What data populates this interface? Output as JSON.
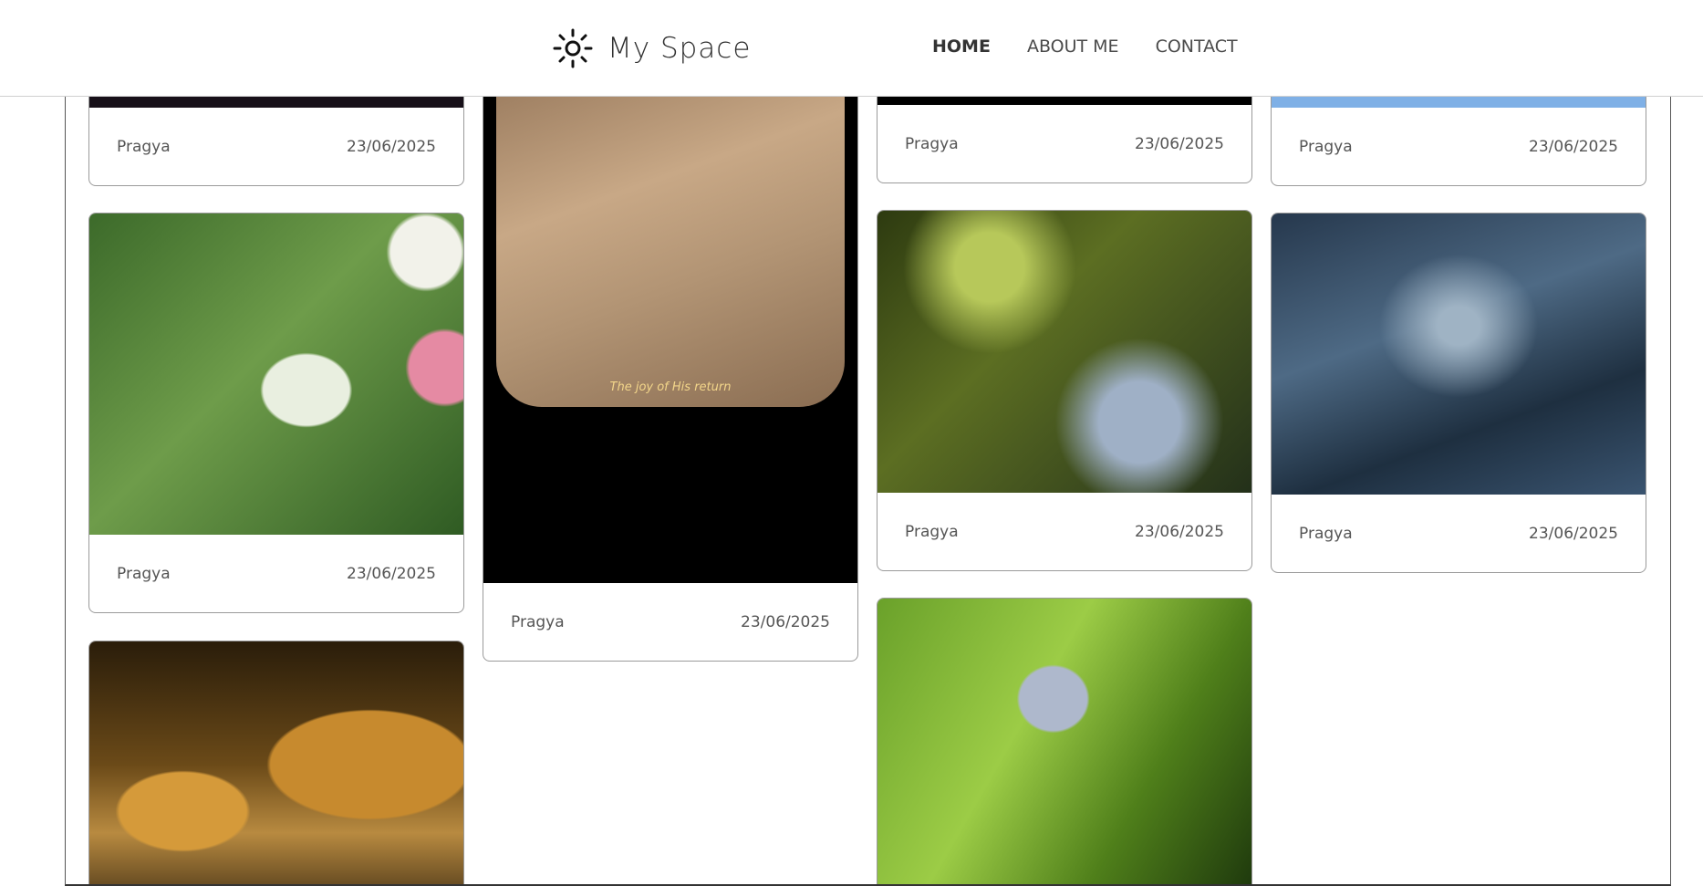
{
  "header": {
    "brand_name": "My Space",
    "brand_icon": "sun-icon",
    "nav": [
      {
        "label": "HOME",
        "active": true
      },
      {
        "label": "ABOUT ME",
        "active": false
      },
      {
        "label": "CONTACT",
        "active": false
      }
    ]
  },
  "cards": [
    {
      "author": "Pragya",
      "date": "23/06/2025",
      "image": "dark-photo"
    },
    {
      "author": "Pragya",
      "date": "23/06/2025",
      "image": "bee-on-daisy-photo"
    },
    {
      "author": "",
      "date": "",
      "image": "pastry-display-photo"
    },
    {
      "author": "Pragya",
      "date": "23/06/2025",
      "image": "joy-of-his-return-photo",
      "caption": "The joy of His return"
    },
    {
      "author": "Pragya",
      "date": "23/06/2025",
      "image": "black-photo"
    },
    {
      "author": "Pragya",
      "date": "23/06/2025",
      "image": "dragonfly-photo"
    },
    {
      "author": "",
      "date": "",
      "image": "butterfly-on-leaf-photo"
    },
    {
      "author": "Pragya",
      "date": "23/06/2025",
      "image": "sky-photo"
    },
    {
      "author": "Pragya",
      "date": "23/06/2025",
      "image": "water-photo"
    }
  ]
}
